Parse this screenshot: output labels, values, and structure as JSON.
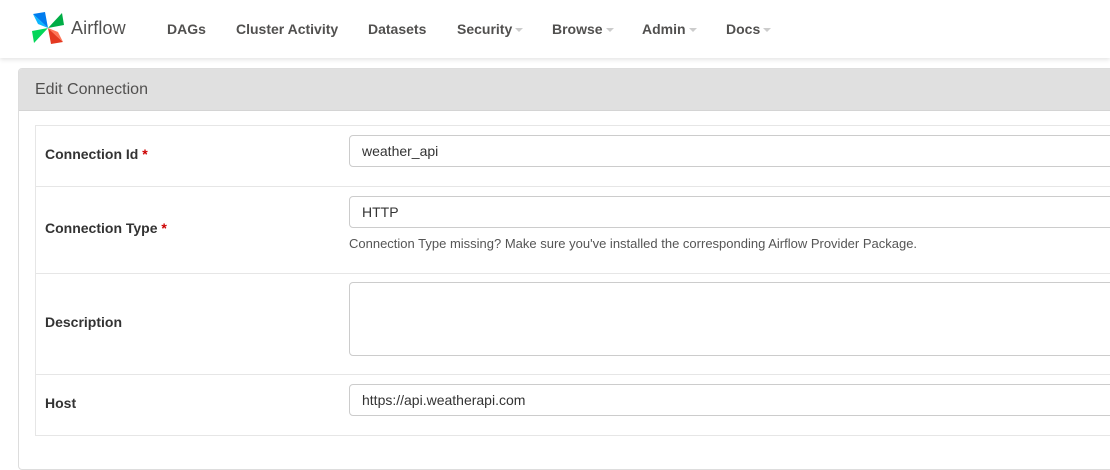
{
  "navbar": {
    "brand": {
      "name": "Airflow",
      "icon": "airflow-pinwheel-icon",
      "colors": [
        "#017cee",
        "#00ad46",
        "#e43921",
        "#04d659",
        "#0cb6ff"
      ]
    },
    "items": [
      {
        "label": "DAGs",
        "has_caret": false
      },
      {
        "label": "Cluster Activity",
        "has_caret": false
      },
      {
        "label": "Datasets",
        "has_caret": false
      },
      {
        "label": "Security",
        "has_caret": true
      },
      {
        "label": "Browse",
        "has_caret": true
      },
      {
        "label": "Admin",
        "has_caret": true
      },
      {
        "label": "Docs",
        "has_caret": true
      }
    ]
  },
  "panel": {
    "title": "Edit Connection"
  },
  "form": {
    "connection_id": {
      "label": "Connection Id",
      "required_mark": "*",
      "value": "weather_api"
    },
    "connection_type": {
      "label": "Connection Type",
      "required_mark": "*",
      "value": "HTTP",
      "help": "Connection Type missing? Make sure you've installed the corresponding Airflow Provider Package."
    },
    "description": {
      "label": "Description",
      "value": ""
    },
    "host": {
      "label": "Host",
      "value": "https://api.weatherapi.com"
    }
  },
  "colors": {
    "required": "#cc0000",
    "panel_heading_bg": "#e0e0e0",
    "nav_text": "#51504f"
  }
}
